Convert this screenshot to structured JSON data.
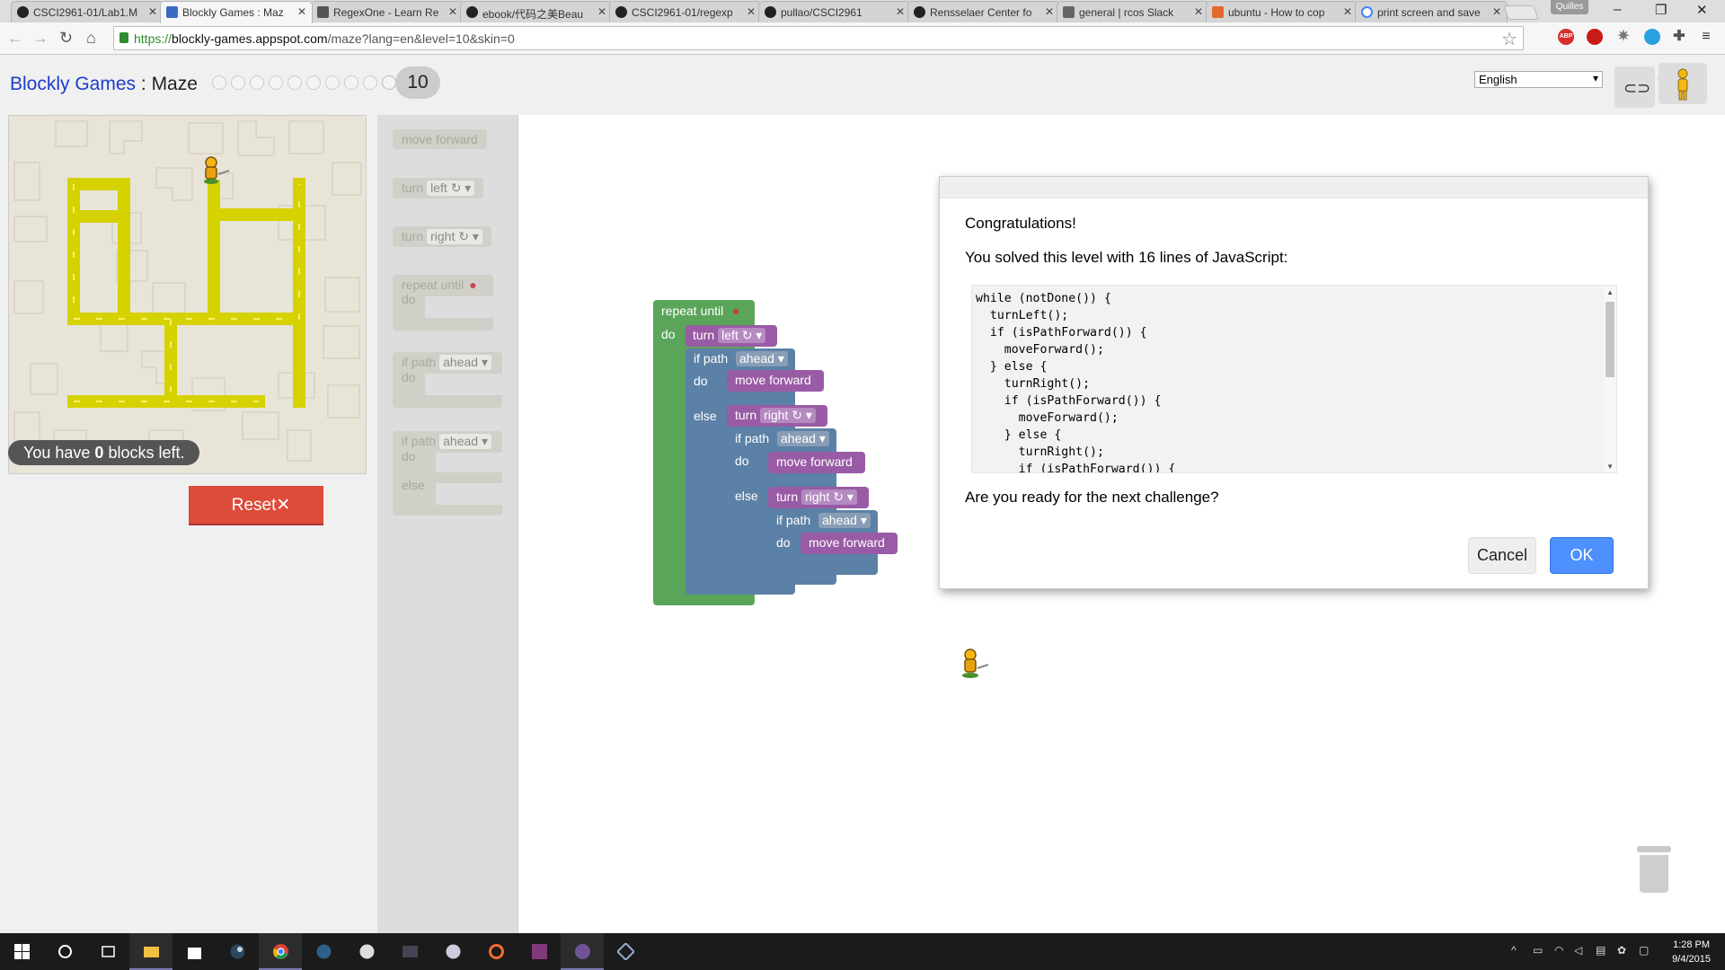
{
  "browser": {
    "tabs": [
      {
        "title": "CSCI2961-01/Lab1.M",
        "active": false
      },
      {
        "title": "Blockly Games : Maz",
        "active": true
      },
      {
        "title": "RegexOne - Learn Re",
        "active": false
      },
      {
        "title": "ebook/代码之美Beau",
        "active": false
      },
      {
        "title": "CSCI2961-01/regexp",
        "active": false
      },
      {
        "title": "pullao/CSCI2961",
        "active": false
      },
      {
        "title": "Rensselaer Center fo",
        "active": false
      },
      {
        "title": "general | rcos Slack",
        "active": false
      },
      {
        "title": "ubuntu - How to cop",
        "active": false
      },
      {
        "title": "print screen and save",
        "active": false
      }
    ],
    "profile_name": "Quilles",
    "url_scheme": "https://",
    "url_host": "blockly-games.appspot.com",
    "url_path": "/maze?lang=en&level=10&skin=0",
    "extensions": {
      "abp": "ABP"
    }
  },
  "page": {
    "brand": "Blockly Games",
    "separator": " : ",
    "game_name": "Maze",
    "current_level": "10",
    "language": "English",
    "blocks_left_prefix": "You have ",
    "blocks_left_count": "0",
    "blocks_left_suffix": " blocks left.",
    "reset_label": "Reset",
    "reset_icon": "✕"
  },
  "toolbox": {
    "move_forward": "move forward",
    "turn": "turn",
    "left": "left ↻",
    "right": "right ↻",
    "repeat_until": "repeat until",
    "do": "do",
    "if_path": "if path",
    "ahead": "ahead",
    "else": "else"
  },
  "program": {
    "repeat_until": "repeat until",
    "do": "do",
    "turn": "turn",
    "left": "left ↻",
    "right": "right ↻",
    "if_path": "if path",
    "ahead": "ahead",
    "move_forward": "move forward",
    "else": "else"
  },
  "dialog": {
    "title": "Congratulations!",
    "message": "You solved this level with 16 lines of JavaScript:",
    "code": "while (notDone()) {\n  turnLeft();\n  if (isPathForward()) {\n    moveForward();\n  } else {\n    turnRight();\n    if (isPathForward()) {\n      moveForward();\n    } else {\n      turnRight();\n      if (isPathForward()) {",
    "question": "Are you ready for the next challenge?",
    "cancel": "Cancel",
    "ok": "OK"
  },
  "taskbar": {
    "time": "1:28 PM",
    "date": "9/4/2015"
  }
}
